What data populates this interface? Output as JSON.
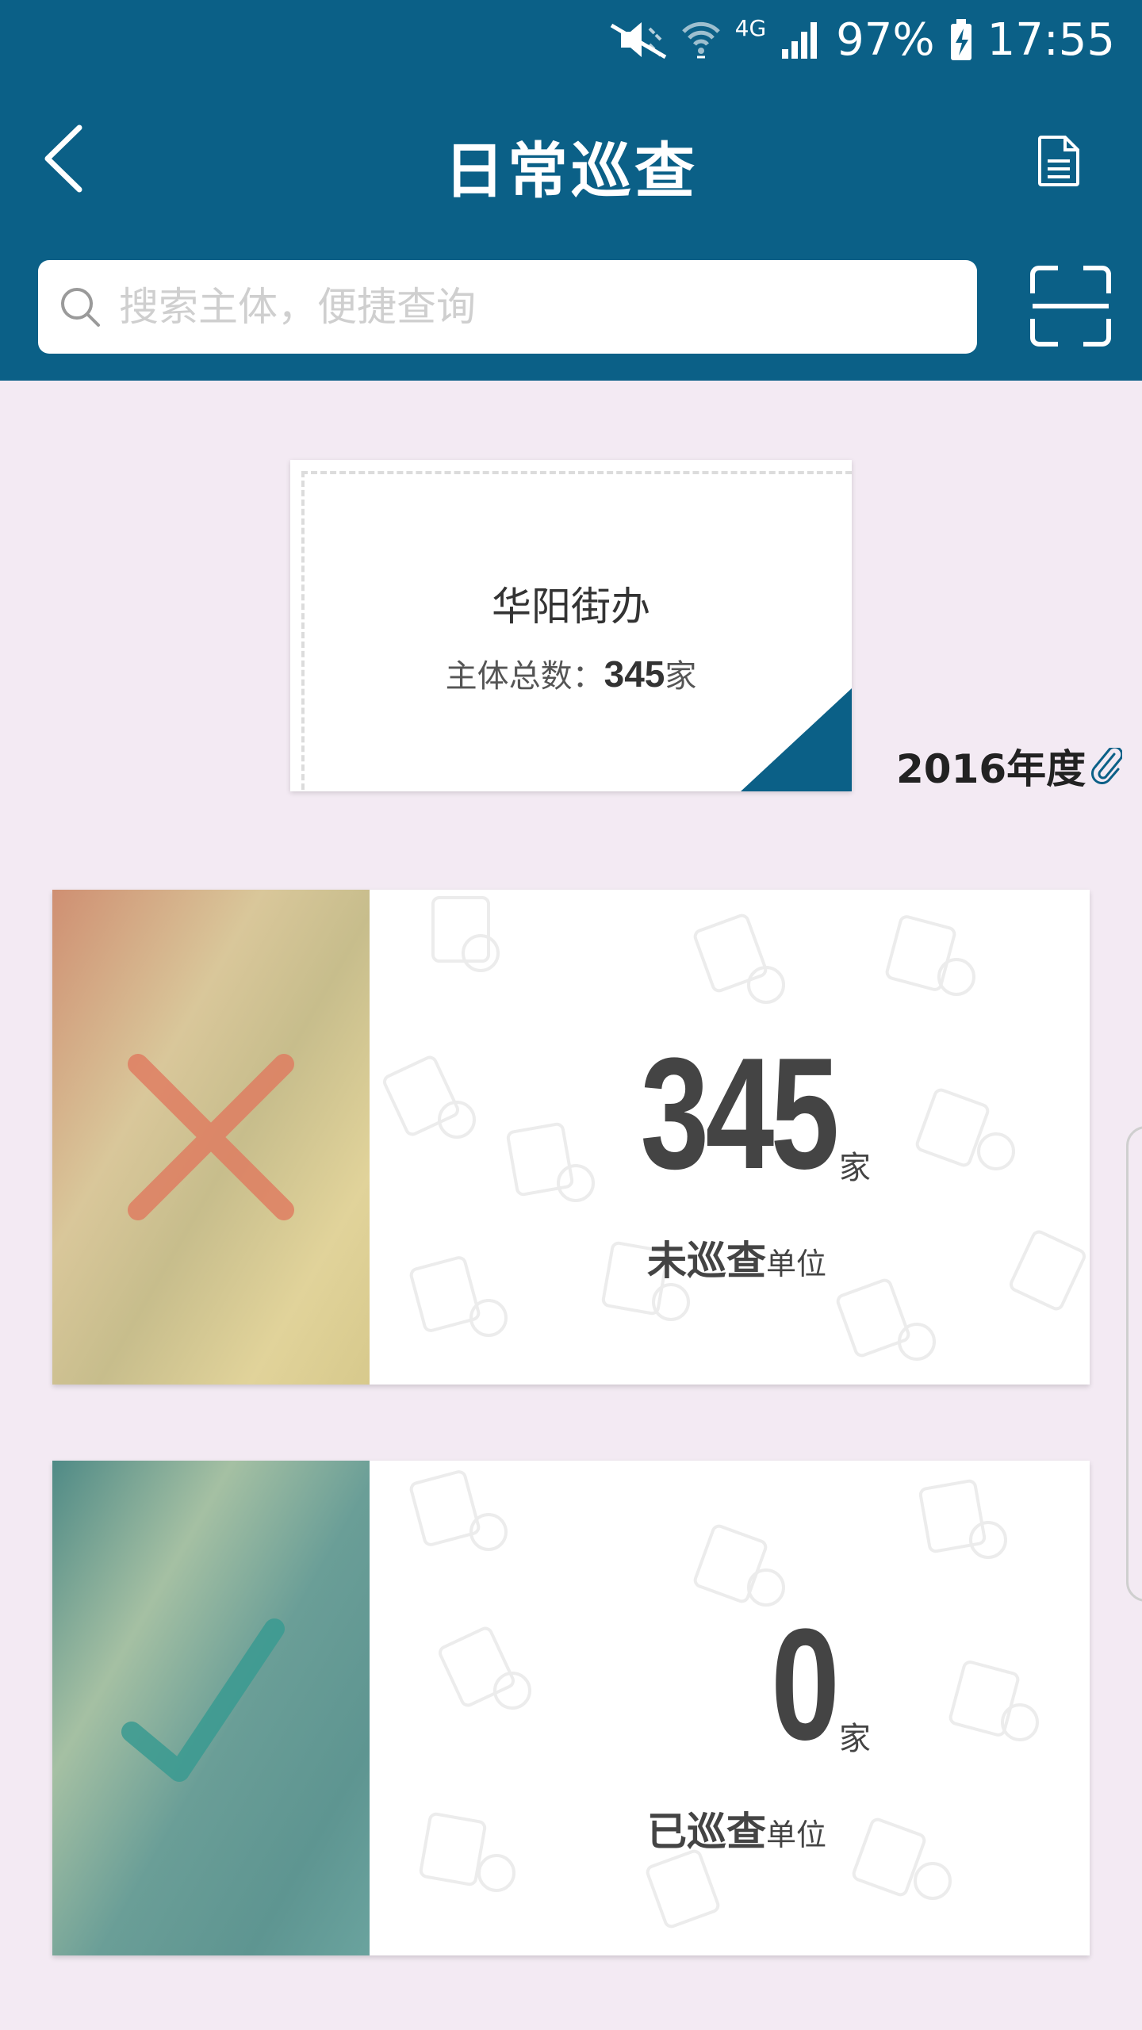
{
  "status_bar": {
    "battery": "97%",
    "time": "17:55",
    "network": "4G",
    "icons": [
      "mute-icon",
      "wifi-icon",
      "signal-icon",
      "battery-charging-icon"
    ]
  },
  "header": {
    "title": "日常巡查",
    "back_icon": "back-chevron-icon",
    "doc_icon": "document-icon",
    "scan_icon": "scan-icon"
  },
  "search": {
    "placeholder": "搜索主体，便捷查询",
    "value": ""
  },
  "summary": {
    "name": "华阳街办",
    "count_prefix": "主体总数：",
    "count": "345",
    "count_unit": "家"
  },
  "year": {
    "label": "2016年度",
    "icon": "paperclip-icon"
  },
  "stats": {
    "unchecked": {
      "number": "345",
      "unit": "家",
      "label_main": "未巡查",
      "label_sub": "单位",
      "icon": "cross-icon"
    },
    "checked": {
      "number": "0",
      "unit": "家",
      "label_main": "已巡查",
      "label_sub": "单位",
      "icon": "check-icon"
    }
  },
  "colors": {
    "primary": "#0b6087",
    "background": "#f3eaf3",
    "unchecked_mark": "#e07a5f",
    "checked_mark": "#3a9a90"
  }
}
